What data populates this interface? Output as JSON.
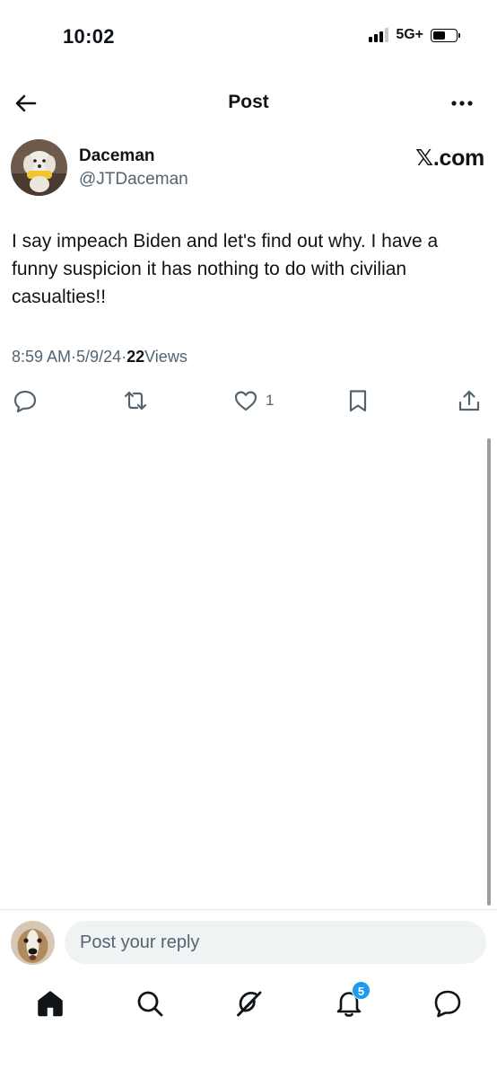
{
  "status_bar": {
    "time": "10:02",
    "network": "5G+"
  },
  "nav": {
    "title": "Post"
  },
  "author": {
    "name": "Daceman",
    "handle": "@JTDaceman",
    "source_label": "𝕏.com"
  },
  "post": {
    "text": "I say impeach Biden and let's find out why.  I have a funny suspicion it has nothing to do with civilian casualties!!",
    "time": "8:59 AM",
    "separator": " · ",
    "date": "5/9/24",
    "views_count": "22",
    "views_label": " Views"
  },
  "actions": {
    "reply_icon": "reply-icon",
    "repost_icon": "repost-icon",
    "like_icon": "heart-icon",
    "like_count": "1",
    "bookmark_icon": "bookmark-icon",
    "share_icon": "share-icon"
  },
  "reply": {
    "placeholder": "Post your reply"
  },
  "tabbar": {
    "items": [
      "home-icon",
      "search-icon",
      "grok-icon",
      "notifications-icon",
      "messages-icon"
    ],
    "notifications_badge": "5"
  },
  "colors": {
    "text": "#0f1419",
    "secondary": "#536471",
    "accent": "#1d9bf0",
    "input_bg": "#eff3f4"
  }
}
